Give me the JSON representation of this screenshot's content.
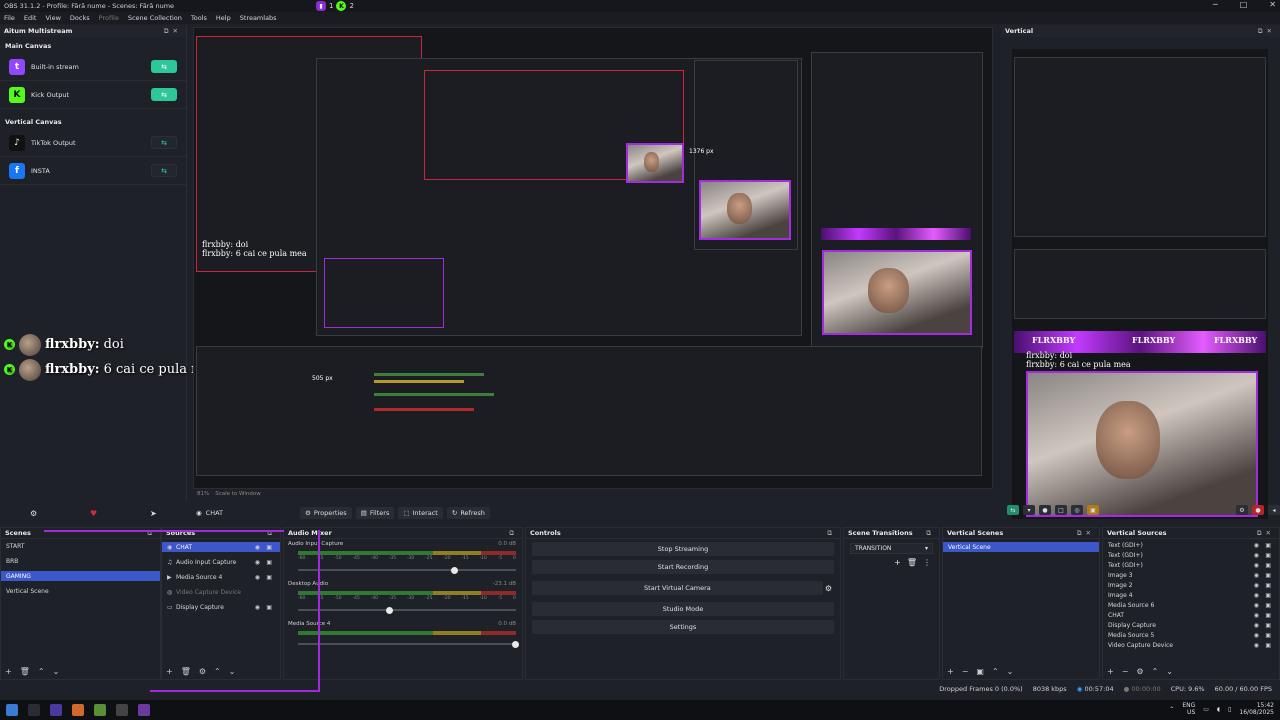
{
  "window": {
    "title": "OBS 31.1.2 - Profile: Fără nume - Scenes: Fără nume",
    "badge_v": "1",
    "badge_k": "2",
    "controls": [
      "─",
      "□",
      "✕"
    ]
  },
  "menu": [
    "File",
    "Edit",
    "View",
    "Docks",
    "Profile",
    "Scene Collection",
    "Tools",
    "Help",
    "Streamlabs"
  ],
  "aitum": {
    "title": "Aitum Multistream",
    "main_canvas": "Main Canvas",
    "vertical_canvas": "Vertical Canvas",
    "outputs_main": [
      {
        "label": "Built-in stream",
        "icon": "twitch-icon",
        "color": "#9146ff",
        "glyph": "t",
        "state": "on"
      },
      {
        "label": "Kick Output",
        "icon": "kick-icon",
        "color": "#53fc18",
        "glyph": "K",
        "state": "on"
      }
    ],
    "outputs_vertical": [
      {
        "label": "TikTok Output",
        "icon": "tiktok-icon",
        "color": "#111",
        "glyph": "♪",
        "state": "off"
      },
      {
        "label": "INSTA",
        "icon": "facebook-icon",
        "color": "#1877f2",
        "glyph": "f",
        "state": "off"
      }
    ]
  },
  "chat": [
    {
      "name": "flrxbby:",
      "text": "doi"
    },
    {
      "name": "flrxbby:",
      "text": "6 cai ce pula mea"
    }
  ],
  "preview": {
    "px_label": "1376 px",
    "px_label2": "505 px",
    "zoom": "81%",
    "scale": "Scale to Window"
  },
  "vertical": {
    "title": "Vertical",
    "banner": "FLRXBBY"
  },
  "toolbar": {
    "source": "CHAT",
    "properties": "Properties",
    "filters": "Filters",
    "interact": "Interact",
    "refresh": "Refresh"
  },
  "scenes": {
    "title": "Scenes",
    "items": [
      "START",
      "BRB",
      "GAMING",
      "Vertical Scene"
    ],
    "selected": 2
  },
  "sources": {
    "title": "Sources",
    "items": [
      {
        "label": "CHAT",
        "icon": "browser-icon"
      },
      {
        "label": "Audio Input Capture",
        "icon": "mic-icon"
      },
      {
        "label": "Media Source 4",
        "icon": "play-icon"
      },
      {
        "label": "Video Capture Device",
        "icon": "camera-icon"
      },
      {
        "label": "Display Capture",
        "icon": "monitor-icon"
      }
    ]
  },
  "mixer": {
    "title": "Audio Mixer",
    "channels": [
      {
        "name": "Audio Input Capture",
        "db": "0.0 dB",
        "level": 0.72
      },
      {
        "name": "Desktop Audio",
        "db": "-23.1 dB",
        "level": 0.42
      },
      {
        "name": "Media Source 4",
        "db": "0.0 dB",
        "level": 1.0
      }
    ],
    "scale": [
      "-60",
      "-55",
      "-50",
      "-45",
      "-40",
      "-35",
      "-30",
      "-25",
      "-20",
      "-15",
      "-10",
      "-5",
      "0"
    ]
  },
  "controls": {
    "title": "Controls",
    "buttons": [
      "Stop Streaming",
      "Start Recording",
      "Start Virtual Camera",
      "Studio Mode",
      "Settings"
    ]
  },
  "transitions": {
    "title": "Scene Transitions",
    "value": "TRANSITION"
  },
  "vscenes": {
    "title": "Vertical Scenes",
    "items": [
      "Vertical Scene"
    ]
  },
  "vsources": {
    "title": "Vertical Sources",
    "items": [
      "Text (GDI+)",
      "Text (GDI+)",
      "Text (GDI+)",
      "Image 3",
      "Image 2",
      "Image 4",
      "Media Source 6",
      "CHAT",
      "Display Capture",
      "Media Source 5",
      "Video Capture Device"
    ]
  },
  "status": {
    "dropped": "Dropped Frames 0 (0.0%)",
    "bitrate": "8038 kbps",
    "stream_time": "00:57:04",
    "rec_time": "00:00:00",
    "cpu": "CPU: 9.6%",
    "fps": "60.00 / 60.00 FPS"
  },
  "tray": {
    "lang": "ENG",
    "region": "US",
    "time": "15:42",
    "date": "16/08/2025"
  }
}
